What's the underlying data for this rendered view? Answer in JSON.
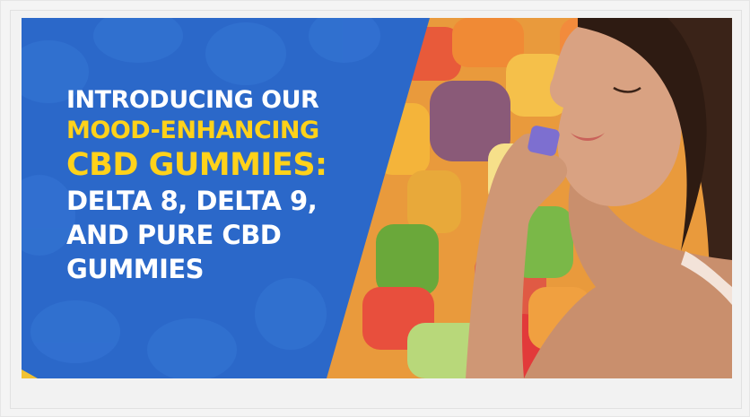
{
  "banner": {
    "headline": {
      "line1": "INTRODUCING OUR",
      "line2": "MOOD-ENHANCING",
      "line3": "CBD GUMMIES:",
      "line4": "DELTA 8, DELTA 9,",
      "line5": "AND PURE CBD",
      "line6": "GUMMIES"
    }
  },
  "colors": {
    "panel_blue": "#2a68c8",
    "accent_yellow": "#ffd21a",
    "text_white": "#ffffff",
    "page_bg": "#f3f3f3"
  },
  "images": {
    "hero": "woman-holding-gummy-illustration",
    "background": "colorful-gummies-pattern"
  }
}
